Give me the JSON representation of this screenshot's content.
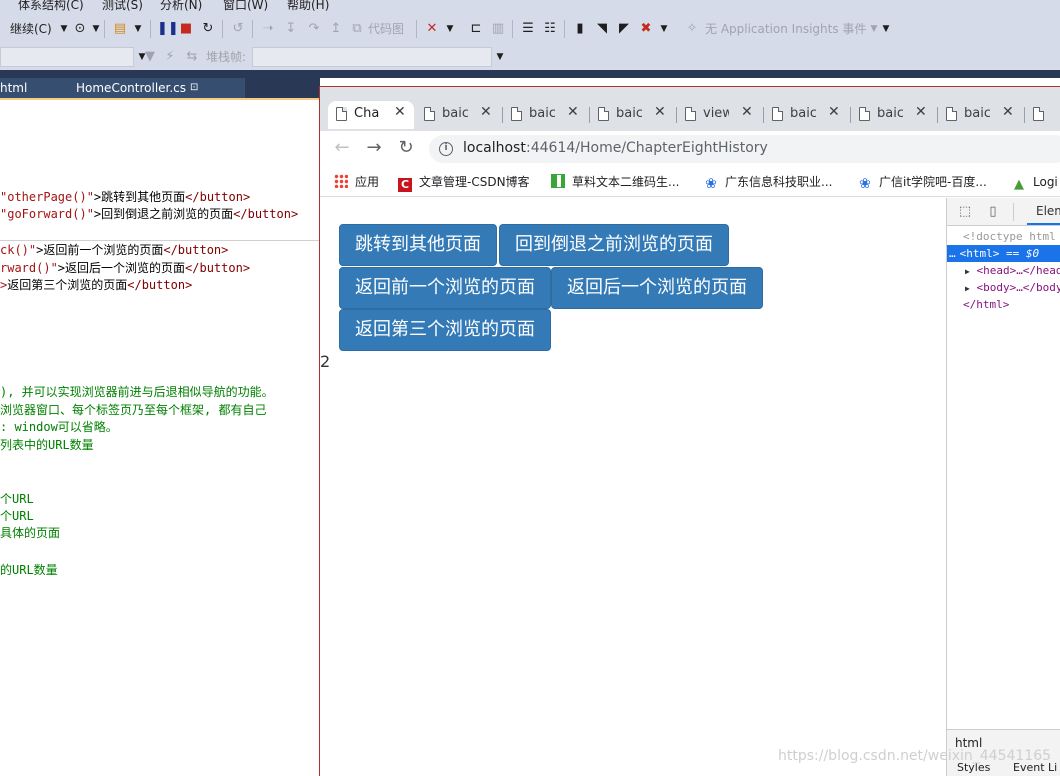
{
  "vs": {
    "menu": [
      "体系结构(C)",
      "测试(S)",
      "分析(N)",
      "窗口(W)",
      "帮助(H)"
    ],
    "toolbar": {
      "continue_label": "继续(C)",
      "code_map_label": "代码图",
      "insights_label": "无 Application Insights 事件",
      "stack_frame_label": "堆栈帧:"
    },
    "tabs": [
      {
        "label": "html"
      },
      {
        "label": "HomeController.cs",
        "pin": "⊡"
      }
    ]
  },
  "code": {
    "lines": [
      {
        "pre": "\"otherPage()\"",
        "mid": ">跳转到其他页面",
        "post": "</button>",
        "kind": "button"
      },
      {
        "pre": "\"goForward()\"",
        "mid": ">回到倒退之前浏览的页面",
        "post": "</button>",
        "kind": "button"
      },
      {
        "pre": "ck()\"",
        "mid": ">返回前一个浏览的页面",
        "post": "</button>",
        "kind": "button"
      },
      {
        "pre": "rward()\"",
        "mid": ">返回后一个浏览的页面",
        "post": "</button>",
        "kind": "button"
      },
      {
        "pre": ">",
        "mid": "返回第三个浏览的页面",
        "post": "</button>",
        "kind": "button"
      },
      {
        "text": "), 并可以实现浏览器前进与后退相似导航的功能。",
        "kind": "comment"
      },
      {
        "text": "浏览器窗口、每个标签页乃至每个框架, 都有自己",
        "kind": "comment"
      },
      {
        "text": ": window可以省略。",
        "kind": "comment"
      },
      {
        "text": "列表中的URL数量",
        "kind": "comment"
      },
      {
        "text": "个URL",
        "kind": "comment"
      },
      {
        "text": "个URL",
        "kind": "comment"
      },
      {
        "text": "具体的页面",
        "kind": "comment"
      },
      {
        "text": "的URL数量",
        "kind": "comment"
      }
    ]
  },
  "browser": {
    "tabs": [
      {
        "title": "Cha",
        "active": true
      },
      {
        "title": "baic"
      },
      {
        "title": "baic"
      },
      {
        "title": "baic"
      },
      {
        "title": "view"
      },
      {
        "title": "baic"
      },
      {
        "title": "baic"
      },
      {
        "title": "baic"
      }
    ],
    "url_host": "localhost",
    "url_path": ":44614/Home/ChapterEightHistory",
    "bookmarks": [
      {
        "label": "应用",
        "icon": "apps-grid-icon"
      },
      {
        "label": "文章管理-CSDN博客",
        "icon": "csdn-logo-icon"
      },
      {
        "label": "草料文本二维码生...",
        "icon": "qr-logo-icon"
      },
      {
        "label": "广东信息科技职业...",
        "icon": "baidu-paw-icon"
      },
      {
        "label": "广信it学院吧-百度...",
        "icon": "baidu-paw-icon"
      },
      {
        "label": "Logi",
        "icon": "triangle-logo-icon"
      }
    ]
  },
  "page": {
    "buttons": [
      "跳转到其他页面",
      "回到倒退之前浏览的页面",
      "返回前一个浏览的页面",
      "返回后一个浏览的页面",
      "返回第三个浏览的页面"
    ],
    "history_length": "2"
  },
  "devtools": {
    "tab_elements": "Elem",
    "doctype": "<!doctype html",
    "html_open": "<html>",
    "selected_suffix": " == $0",
    "head_line": "<head>…</head>",
    "body_line": "<body>…</body>",
    "html_close": "</html>",
    "bottom_tab": "html",
    "bottom_tabs_2": [
      "Styles",
      "Event Li"
    ]
  },
  "watermark": "https://blog.csdn.net/weixin_44541165",
  "colors": {
    "button_bg": "#337ab7",
    "vs_chrome": "#d6dbe9",
    "vs_dark": "#293955"
  }
}
